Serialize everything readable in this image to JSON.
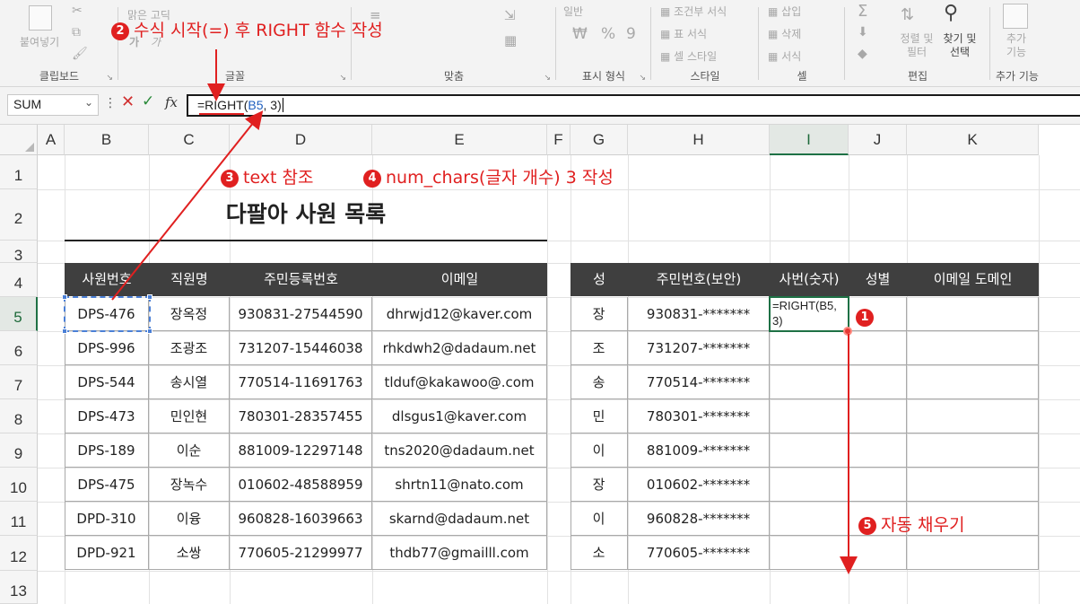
{
  "ribbon": {
    "font_name": "맑은 고딕",
    "paste_label": "붙여넣기",
    "number_format": "일반",
    "conditional_format": "조건부 서식",
    "table_format": "표 서식",
    "cell_style": "셀 스타일",
    "insert": "삽입",
    "delete": "삭제",
    "format": "서식",
    "sort_filter": "정렬 및 필터",
    "find_select": "찾기 및 선택",
    "addins": "추가 기능",
    "groups": [
      "클립보드",
      "글꼴",
      "맞춤",
      "표시 형식",
      "스타일",
      "셀",
      "편집",
      "추가 기능"
    ]
  },
  "formula_bar": {
    "name_box": "SUM",
    "formula_prefix": "=RIGHT(",
    "formula_ref": "B5",
    "formula_sep": ", ",
    "formula_num": "3",
    "formula_end": ")"
  },
  "columns": [
    "A",
    "B",
    "C",
    "D",
    "E",
    "F",
    "G",
    "H",
    "I",
    "J",
    "K"
  ],
  "rows": [
    "1",
    "2",
    "3",
    "4",
    "5",
    "6",
    "7",
    "8",
    "9",
    "10",
    "11",
    "12",
    "13"
  ],
  "title": "다팔아 사원 목록",
  "left_table": {
    "headers": [
      "사원번호",
      "직원명",
      "주민등록번호",
      "이메일"
    ],
    "rows": [
      [
        "DPS-476",
        "장옥정",
        "930831-27544590",
        "dhrwjd12@kaver.com"
      ],
      [
        "DPS-996",
        "조광조",
        "731207-15446038",
        "rhkdwh2@dadaum.net"
      ],
      [
        "DPS-544",
        "송시열",
        "770514-11691763",
        "tlduf@kakawoo@.com"
      ],
      [
        "DPS-473",
        "민인현",
        "780301-28357455",
        "dlsgus1@kaver.com"
      ],
      [
        "DPS-189",
        "이순",
        "881009-12297148",
        "tns2020@dadaum.net"
      ],
      [
        "DPS-475",
        "장녹수",
        "010602-48588959",
        "shrtn11@nato.com"
      ],
      [
        "DPD-310",
        "이융",
        "960828-16039663",
        "skarnd@dadaum.net"
      ],
      [
        "DPD-921",
        "소쌍",
        "770605-21299977",
        "thdb77@gmailll.com"
      ]
    ]
  },
  "right_table": {
    "headers": [
      "성",
      "주민번호(보안)",
      "사번(숫자)",
      "성별",
      "이메일 도메인"
    ],
    "rows": [
      [
        "장",
        "930831-*******"
      ],
      [
        "조",
        "731207-*******"
      ],
      [
        "송",
        "770514-*******"
      ],
      [
        "민",
        "780301-*******"
      ],
      [
        "이",
        "881009-*******"
      ],
      [
        "장",
        "010602-*******"
      ],
      [
        "이",
        "960828-*******"
      ],
      [
        "소",
        "770605-*******"
      ]
    ],
    "editing_cell_line1": "=RIGHT(B5,",
    "editing_cell_line2": "3)"
  },
  "annotations": {
    "step1_num": "1",
    "step2_num": "2",
    "step2_text": "수식 시작(=) 후 RIGHT 함수 작성",
    "step3_num": "3",
    "step3_text": "text 참조",
    "step4_num": "4",
    "step4_text": "num_chars(글자 개수) 3 작성",
    "step5_num": "5",
    "step5_text": "자동 채우기",
    "color": "#e02020"
  }
}
